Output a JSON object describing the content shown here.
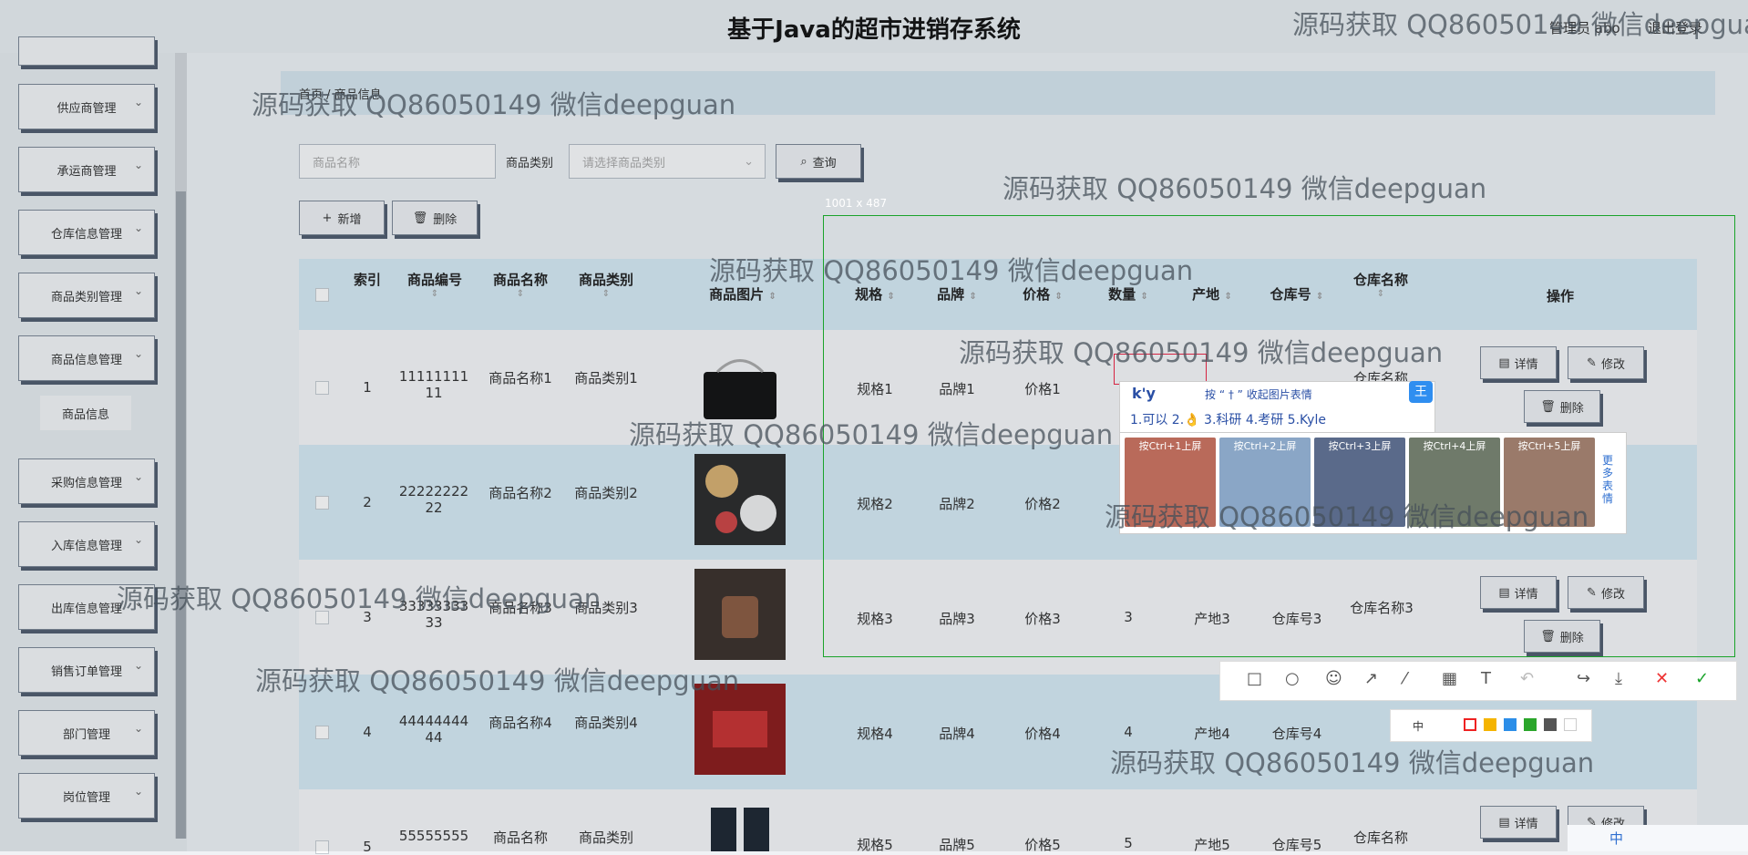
{
  "header": {
    "title": "基于Java的超市进销存系统",
    "user": "管理员 abo",
    "logout": "退出登录"
  },
  "sidebar": {
    "items": [
      {
        "label": "供应商管理"
      },
      {
        "label": "承运商管理"
      },
      {
        "label": "仓库信息管理"
      },
      {
        "label": "商品类别管理"
      },
      {
        "label": "商品信息管理"
      },
      {
        "label": "采购信息管理"
      },
      {
        "label": "入库信息管理"
      },
      {
        "label": "出库信息管理"
      },
      {
        "label": "销售订单管理"
      },
      {
        "label": "部门管理"
      },
      {
        "label": "岗位管理"
      }
    ],
    "sub_item": "商品信息"
  },
  "breadcrumb": "首页 / 商品信息",
  "search": {
    "name_placeholder": "商品名称",
    "category_label": "商品类别",
    "category_placeholder": "请选择商品类别",
    "query_button": "查询"
  },
  "actions": {
    "add": "新增",
    "delete": "删除"
  },
  "table": {
    "headers": [
      "索引",
      "商品编号",
      "商品名称",
      "商品类别",
      "商品图片",
      "规格",
      "品牌",
      "价格",
      "数量",
      "产地",
      "仓库号",
      "仓库名称",
      "操作"
    ],
    "rows": [
      {
        "index": "1",
        "code": "1111111111",
        "name": "商品名称1",
        "category": "商品类别1",
        "spec": "规格1",
        "brand": "品牌1",
        "price": "价格1",
        "qty": "",
        "origin": "",
        "wh_no": "",
        "wh_name": "仓库名称"
      },
      {
        "index": "2",
        "code": "2222222222",
        "name": "商品名称2",
        "category": "商品类别2",
        "spec": "规格2",
        "brand": "品牌2",
        "price": "价格2",
        "qty": "",
        "origin": "",
        "wh_no": "",
        "wh_name": ""
      },
      {
        "index": "3",
        "code": "3333333333",
        "name": "商品名称3",
        "category": "商品类别3",
        "spec": "规格3",
        "brand": "品牌3",
        "price": "价格3",
        "qty": "3",
        "origin": "产地3",
        "wh_no": "仓库号3",
        "wh_name": "仓库名称3"
      },
      {
        "index": "4",
        "code": "4444444444",
        "name": "商品名称4",
        "category": "商品类别4",
        "spec": "规格4",
        "brand": "品牌4",
        "price": "价格4",
        "qty": "4",
        "origin": "产地4",
        "wh_no": "仓库号4",
        "wh_name": "仓库名称"
      },
      {
        "index": "5",
        "code": "55555555",
        "name": "商品名称",
        "category": "商品类别",
        "spec": "规格5",
        "brand": "品牌5",
        "price": "价格5",
        "qty": "5",
        "origin": "产地5",
        "wh_no": "仓库号5",
        "wh_name": "仓库名称"
      }
    ],
    "detail_label": "详情",
    "edit_label": "修改",
    "delete_label": "删除"
  },
  "screenshot_tool": {
    "size_label": "1001 x 487",
    "font_size_label": "中"
  },
  "ime": {
    "input": "k'y",
    "hint": "按 “ † ” 收起图片表情",
    "candidates": "1.可以  2.👌  3.科研  4.考研  5.Kyle",
    "sticker_captions": [
      "按Ctrl+1上屏",
      "按Ctrl+2上屏",
      "按Ctrl+3上屏",
      "按Ctrl+4上屏",
      "按Ctrl+5上屏"
    ],
    "more": "更多表情",
    "logo": "王"
  },
  "watermark": "源码获取 QQ86050149 微信deepguan",
  "colors": {
    "accent_green": "#1aa32a",
    "header_bg": "#d7ebf5",
    "selected_row": "#d7ebf5"
  },
  "tray": "中"
}
